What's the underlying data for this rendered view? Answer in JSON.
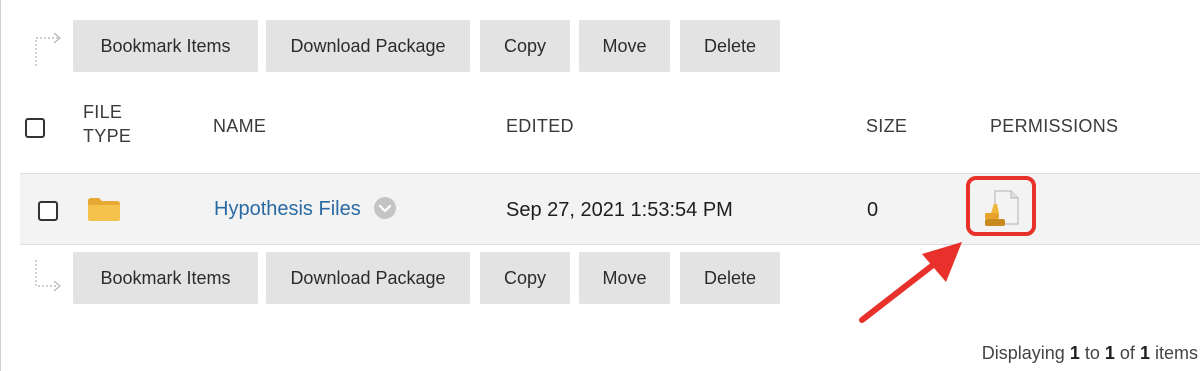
{
  "toolbar_top": {
    "buttons": [
      "Bookmark Items",
      "Download Package",
      "Copy",
      "Move",
      "Delete"
    ]
  },
  "table": {
    "headers": {
      "file_type": "FILE TYPE",
      "name": "NAME",
      "edited": "EDITED",
      "size": "SIZE",
      "permissions": "PERMISSIONS"
    },
    "rows": [
      {
        "file_type_icon": "folder-icon",
        "name": "Hypothesis Files",
        "edited": "Sep 27, 2021 1:53:54 PM",
        "size": "0",
        "permissions_icon": "permissions-document-icon"
      }
    ]
  },
  "toolbar_bottom": {
    "buttons": [
      "Bookmark Items",
      "Download Package",
      "Copy",
      "Move",
      "Delete"
    ]
  },
  "footer": {
    "prefix": "Displaying",
    "start": "1",
    "to": "to",
    "end": "1",
    "of": "of",
    "total": "1",
    "suffix": "items"
  },
  "colors": {
    "highlight": "#e8312a",
    "link": "#2a6aa3",
    "button_bg": "#e3e3e3",
    "row_bg": "#f3f3f3"
  }
}
